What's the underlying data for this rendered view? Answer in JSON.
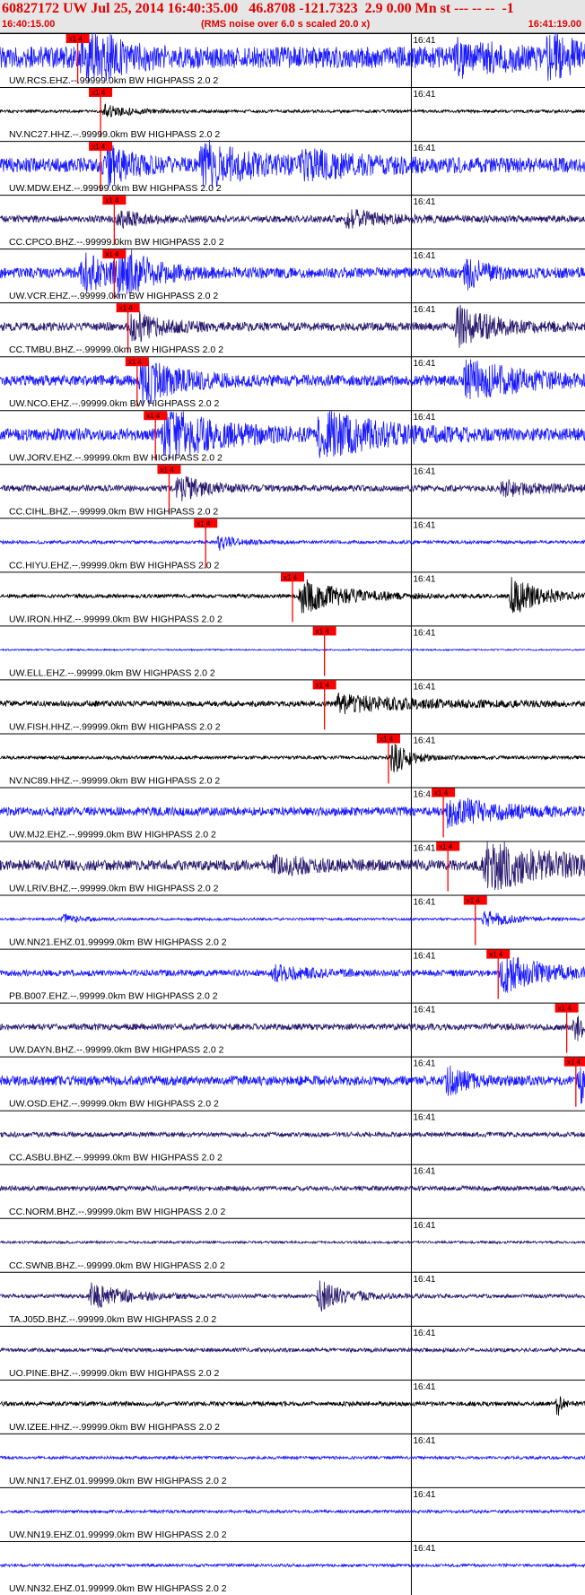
{
  "header": {
    "title": "60827172 UW Jul 25, 2014 16:40:35.00   46.8708 -121.7323  2.9 0.00 Mn st --- -- --  -1",
    "start_time": "16:40:15.00",
    "note": "(RMS noise over 6.0 s scaled 20.0 x)",
    "end_time": "16:41:19.00"
  },
  "colors": {
    "header_text": "#e00000",
    "blue": "#1a1aff",
    "navy": "#2a1a6e",
    "black": "#000000",
    "pick": "#ff0000"
  },
  "chart_data": {
    "type": "line",
    "x_unit": "seconds after 16:40:15.00",
    "xlim": [
      0,
      64
    ],
    "time_tick": {
      "label": "16:41",
      "at": 45
    },
    "pick_label": "x1 4",
    "traces": [
      {
        "label": "UW.RCS.EHZ.--.99999.0km BW  HIGHPASS  2.0  2",
        "color": "blue",
        "pick": 8.5,
        "amp": 0.45,
        "events": [
          [
            9,
            2,
            0.9
          ],
          [
            10,
            3,
            0.7
          ],
          [
            50,
            6,
            0.5
          ],
          [
            60,
            3,
            0.7
          ]
        ]
      },
      {
        "label": "NV.NC27.HHZ.--.99999.0km BW  HIGHPASS  2.0  2",
        "color": "black",
        "pick": 11.0,
        "amp": 0.06,
        "events": [
          [
            11.5,
            3,
            0.25
          ]
        ]
      },
      {
        "label": "UW.MDW.EHZ.--.99999.0km BW  HIGHPASS  2.0  2",
        "color": "blue",
        "pick": 11.0,
        "amp": 0.3,
        "events": [
          [
            11.5,
            3,
            0.7
          ],
          [
            22,
            5,
            0.9
          ],
          [
            33,
            6,
            0.45
          ]
        ]
      },
      {
        "label": "CC.CPCO.BHZ.--.99999.0km BW  HIGHPASS  2.0  2",
        "color": "navy",
        "pick": 12.5,
        "amp": 0.14,
        "events": [
          [
            13,
            3,
            0.3
          ],
          [
            38,
            4,
            0.35
          ]
        ]
      },
      {
        "label": "UW.VCR.EHZ.--.99999.0km BW  HIGHPASS  2.0  2",
        "color": "blue",
        "pick": 12.5,
        "amp": 0.22,
        "events": [
          [
            9,
            4,
            0.7
          ],
          [
            13,
            3,
            0.9
          ],
          [
            51,
            2,
            0.6
          ]
        ]
      },
      {
        "label": "CC.TMBU.BHZ.--.99999.0km BW  HIGHPASS  2.0  2",
        "color": "navy",
        "pick": 14.0,
        "amp": 0.18,
        "events": [
          [
            14.5,
            3,
            0.6
          ],
          [
            50,
            4,
            0.8
          ]
        ]
      },
      {
        "label": "UW.NCO.EHZ.--.99999.0km BW  HIGHPASS  2.0  2",
        "color": "blue",
        "pick": 15.0,
        "amp": 0.22,
        "events": [
          [
            15.5,
            4,
            0.9
          ],
          [
            51,
            6,
            0.8
          ]
        ]
      },
      {
        "label": "UW.JORV.EHZ.--.99999.0km BW  HIGHPASS  2.0  2",
        "color": "blue",
        "pick": 17.0,
        "amp": 0.25,
        "events": [
          [
            18,
            6,
            1.0
          ],
          [
            35,
            6,
            0.95
          ]
        ]
      },
      {
        "label": "CC.CIHL.BHZ.--.99999.0km BW  HIGHPASS  2.0  2",
        "color": "navy",
        "pick": 18.5,
        "amp": 0.13,
        "events": [
          [
            19.5,
            3,
            0.5
          ],
          [
            55,
            4,
            0.3
          ]
        ]
      },
      {
        "label": "CC.HIYU.EHZ.--.99999.0km BW  HIGHPASS  2.0  2",
        "color": "blue",
        "pick": 22.5,
        "amp": 0.07,
        "events": [
          [
            24,
            2,
            0.3
          ]
        ]
      },
      {
        "label": "UW.IRON.HHZ.--.99999.0km BW  HIGHPASS  2.0  2",
        "color": "black",
        "pick": 32.0,
        "amp": 0.08,
        "events": [
          [
            33,
            5,
            0.7
          ],
          [
            56,
            3,
            0.8
          ]
        ]
      },
      {
        "label": "UW.ELL.EHZ.--.99999.0km BW  HIGHPASS  2.0  2",
        "color": "blue",
        "pick": 35.5,
        "amp": 0.03,
        "events": []
      },
      {
        "label": "UW.FISH.HHZ.--.99999.0km BW  HIGHPASS  2.0  2",
        "color": "black",
        "pick": 35.5,
        "amp": 0.12,
        "events": [
          [
            37,
            8,
            0.35
          ]
        ]
      },
      {
        "label": "NV.NC89.HHZ.--.99999.0km BW  HIGHPASS  2.0  2",
        "color": "black",
        "pick": 42.5,
        "amp": 0.07,
        "events": [
          [
            43,
            1.5,
            0.9
          ]
        ]
      },
      {
        "label": "UW.MJ2.EHZ.--.99999.0km BW  HIGHPASS  2.0  2",
        "color": "blue",
        "pick": 48.5,
        "amp": 0.18,
        "events": [
          [
            49,
            5,
            0.6
          ]
        ]
      },
      {
        "label": "UW.LRIV.BHZ.--.99999.0km BW  HIGHPASS  2.0  2",
        "color": "navy",
        "pick": 49.0,
        "amp": 0.22,
        "events": [
          [
            30,
            4,
            0.35
          ],
          [
            53,
            8,
            1.0
          ]
        ]
      },
      {
        "label": "UW.NN21.EHZ.01.99999.0km BW  HIGHPASS  2.0  2",
        "color": "blue",
        "pick": 52.0,
        "amp": 0.05,
        "events": [
          [
            53,
            3,
            0.35
          ],
          [
            7,
            2,
            0.2
          ]
        ]
      },
      {
        "label": "PB.B007.EHZ.--.99999.0km BW  HIGHPASS  2.0  2",
        "color": "blue",
        "pick": 54.5,
        "amp": 0.13,
        "events": [
          [
            55,
            5,
            0.8
          ],
          [
            30,
            4,
            0.3
          ]
        ]
      },
      {
        "label": "UW.DAYN.BHZ.--.99999.0km BW  HIGHPASS  2.0  2",
        "color": "navy",
        "pick": 62.0,
        "amp": 0.13,
        "events": [
          [
            63,
            2,
            0.55
          ]
        ]
      },
      {
        "label": "UW.OSD.EHZ.--.99999.0km BW  HIGHPASS  2.0  2",
        "color": "blue",
        "pick": 63.0,
        "amp": 0.2,
        "events": [
          [
            49,
            2,
            0.6
          ],
          [
            63.5,
            2,
            0.8
          ]
        ]
      },
      {
        "label": "CC.ASBU.BHZ.--.99999.0km BW  HIGHPASS  2.0  2",
        "color": "navy",
        "pick": null,
        "amp": 0.1,
        "events": []
      },
      {
        "label": "CC.NORM.BHZ.--.99999.0km BW  HIGHPASS  2.0  2",
        "color": "navy",
        "pick": null,
        "amp": 0.1,
        "events": []
      },
      {
        "label": "CC.SWNB.BHZ.--.99999.0km BW  HIGHPASS  2.0  2",
        "color": "navy",
        "pick": null,
        "amp": 0.05,
        "events": []
      },
      {
        "label": "TA.J05D.BHZ.--.99999.0km BW  HIGHPASS  2.0  2",
        "color": "navy",
        "pick": null,
        "amp": 0.08,
        "events": [
          [
            10,
            4,
            0.5
          ],
          [
            35,
            3,
            0.6
          ]
        ]
      },
      {
        "label": "UO.PINE.BHZ.--.99999.0km BW  HIGHPASS  2.0  2",
        "color": "navy",
        "pick": null,
        "amp": 0.08,
        "events": []
      },
      {
        "label": "UW.IZEE.HHZ.--.99999.0km BW  HIGHPASS  2.0  2",
        "color": "black",
        "pick": null,
        "amp": 0.09,
        "events": [
          [
            61,
            0.6,
            0.5
          ]
        ]
      },
      {
        "label": "UW.NN17.EHZ.01.99999.0km BW  HIGHPASS  2.0  2",
        "color": "blue",
        "pick": null,
        "amp": 0.06,
        "events": []
      },
      {
        "label": "UW.NN19.EHZ.01.99999.0km BW  HIGHPASS  2.0  2",
        "color": "blue",
        "pick": null,
        "amp": 0.06,
        "events": []
      },
      {
        "label": "UW.NN32.EHZ.01.99999.0km BW  HIGHPASS  2.0  2",
        "color": "blue",
        "pick": null,
        "amp": 0.06,
        "events": []
      }
    ]
  }
}
